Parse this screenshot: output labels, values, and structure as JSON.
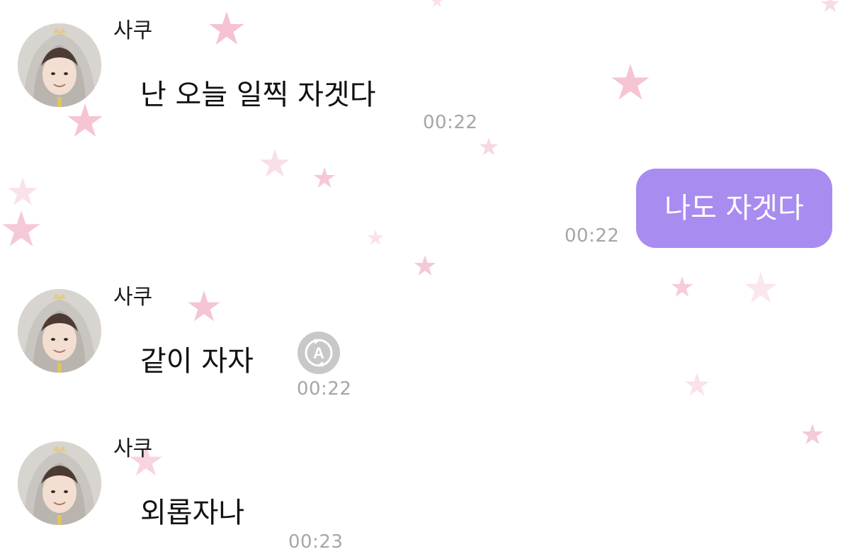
{
  "colors": {
    "my_bubble": "#a88cf0",
    "timestamp": "#a6a6a6",
    "star": "#f2b7c9",
    "translate_icon": "#c8c8c8"
  },
  "messages": [
    {
      "sender": "사쿠",
      "text": "난 오늘 일찍 자겟다",
      "time": "00:22"
    },
    {
      "me": true,
      "text": "나도 자겟다",
      "time": "00:22"
    },
    {
      "sender": "사쿠",
      "text": "같이 자자",
      "time": "00:22",
      "icon": "translate-icon"
    },
    {
      "sender": "사쿠",
      "text": "외롭자나",
      "time": "00:23"
    }
  ],
  "translate_icon_glyph": "A"
}
